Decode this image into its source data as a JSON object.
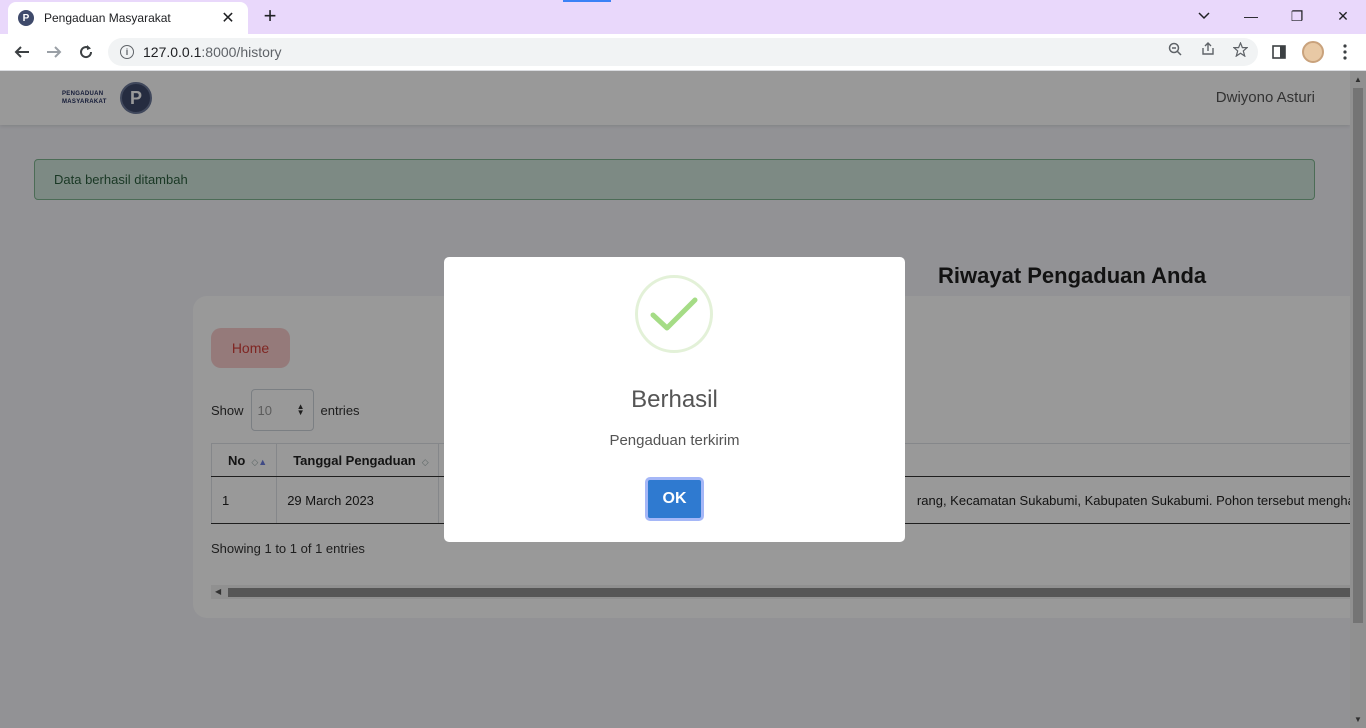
{
  "browser": {
    "tab_title": "Pengaduan Masyarakat",
    "tab_close": "✕",
    "new_tab": "+",
    "url_host": "127.0.0.1",
    "url_path": ":8000/history",
    "window_controls": {
      "minimize": "—",
      "restore": "❐",
      "close": "✕"
    }
  },
  "navbar": {
    "brand_line1": "PENGADUAN",
    "brand_line2": "MASYARAKAT",
    "logo_letter": "P",
    "username": "Dwiyono Asturi"
  },
  "alert": {
    "text": "Data berhasil ditambah"
  },
  "page": {
    "heading": "Riwayat Pengaduan Anda"
  },
  "card": {
    "home_button": "Home",
    "show_label": "Show",
    "entries_label": "entries",
    "length_value": "10",
    "table": {
      "headers": [
        "No",
        "Tanggal Pengaduan",
        ""
      ],
      "rows": [
        {
          "no": "1",
          "date": "29 March 2023",
          "prefix": "…",
          "detail": "rang, Kecamatan Sukabumi, Kabupaten Sukabumi. Pohon tersebut menghalang"
        }
      ]
    },
    "info": "Showing 1 to 1 of 1 entries"
  },
  "modal": {
    "title": "Berhasil",
    "text": "Pengaduan terkirim",
    "ok_label": "OK",
    "icon": "check-icon"
  },
  "colors": {
    "tab_strip": "#e9d8fb",
    "alert_bg": "#d1e7dd",
    "home_button_bg": "#f8cccc",
    "ok_button": "#2f7ad0",
    "success_check": "#a5dc86"
  }
}
